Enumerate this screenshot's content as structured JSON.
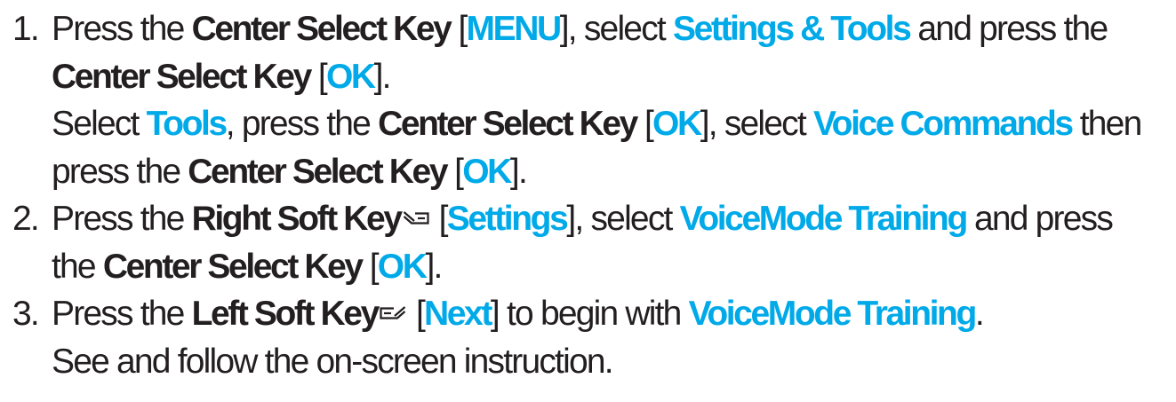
{
  "steps": [
    {
      "number": "1.",
      "l1": {
        "t1": "Press the ",
        "b1": "Center Select Key",
        "t2": " [",
        "h1": "MENU",
        "t3": "], select ",
        "h2": "Settings & Tools",
        "t4": " and press the"
      },
      "l2": {
        "b1": "Center Select Key",
        "t1": " [",
        "h1": "OK",
        "t2": "]."
      },
      "l3": {
        "t1": "Select ",
        "h1": "Tools",
        "t2": ", press the ",
        "b1": "Center Select Key",
        "t3": " [",
        "h2": "OK",
        "t4": "], select ",
        "h3": "Voice Commands",
        "t5": " then"
      },
      "l4": {
        "t1": "press the ",
        "b1": "Center Select Key",
        "t2": " [",
        "h1": "OK",
        "t3": "]."
      }
    },
    {
      "number": "2.",
      "l1": {
        "t1": "Press the ",
        "b1": "Right Soft Key",
        "icon": "right-soft-key-icon",
        "t2": " [",
        "h1": "Settings",
        "t3": "], select ",
        "h2": "VoiceMode Training",
        "t4": " and press"
      },
      "l2": {
        "t1": "the ",
        "b1": "Center Select Key",
        "t2": " [",
        "h1": "OK",
        "t3": "]."
      }
    },
    {
      "number": "3.",
      "l1": {
        "t1": "Press the ",
        "b1": "Left Soft Key",
        "icon": "left-soft-key-icon",
        "t2": " [",
        "h1": "Next",
        "t3": "] to begin with ",
        "h2": "VoiceMode Training",
        "t4": "."
      },
      "l2": {
        "t1": "See and follow the on-screen instruction."
      }
    }
  ],
  "colors": {
    "text": "#231f20",
    "highlight": "#00a9e8",
    "background": "#ffffff"
  }
}
